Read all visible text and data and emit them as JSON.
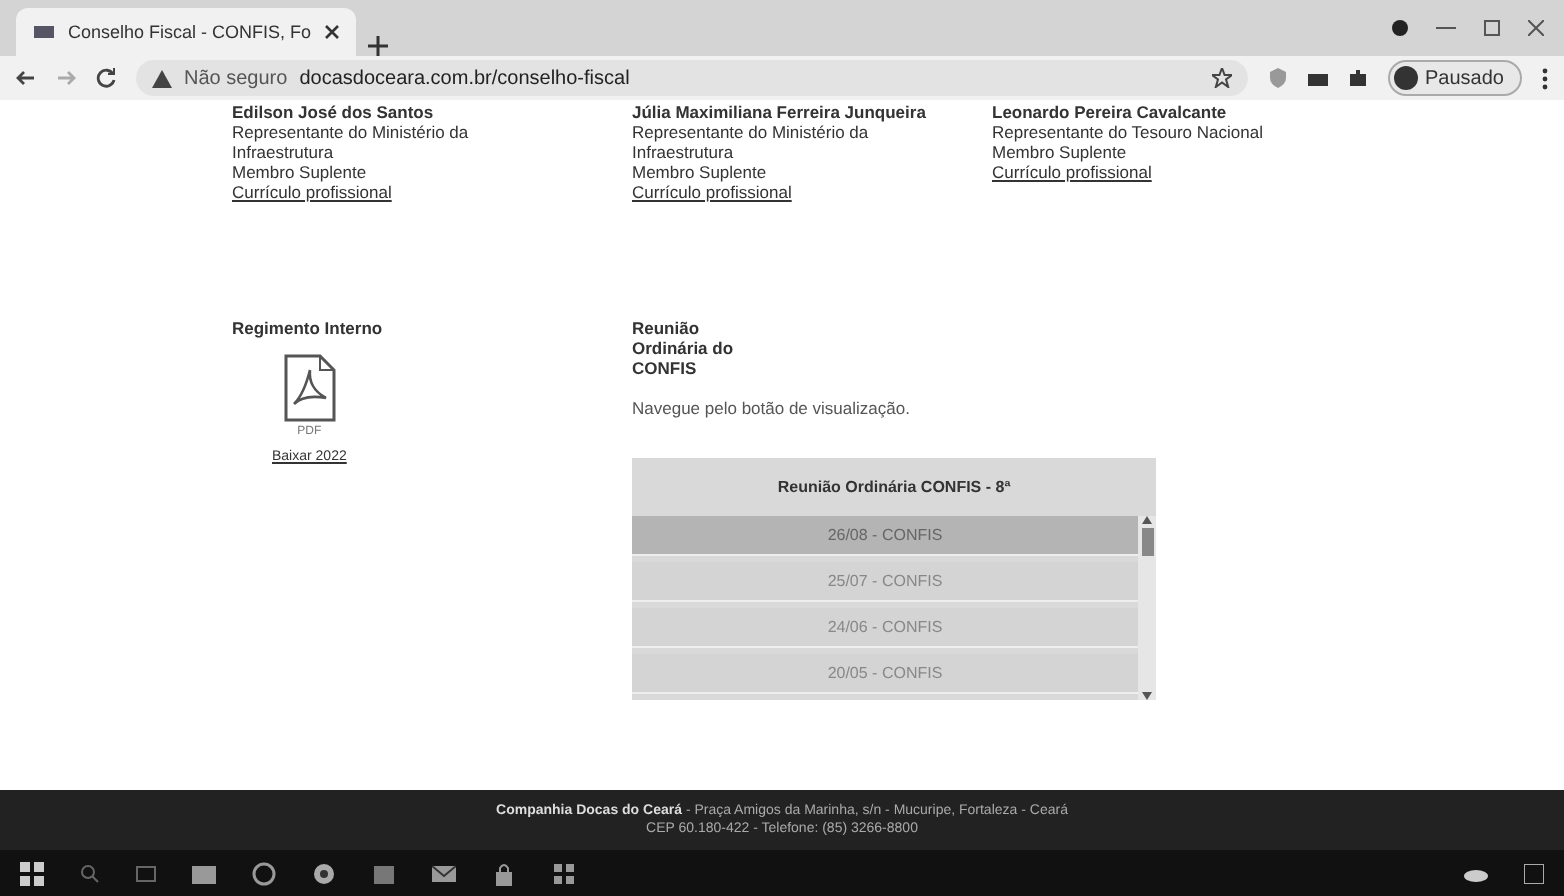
{
  "browser": {
    "tab": {
      "title": "Conselho Fiscal - CONFIS, Fo",
      "selected": true
    },
    "address": {
      "security": "Não seguro",
      "url": "docasdoceara.com.br/conselho-fiscal"
    },
    "profile": "Pausado"
  },
  "members": [
    {
      "name": "Edilson José dos Santos",
      "role": "Representante do Ministério da Infraestrutura",
      "status": "Membro Suplente",
      "link": "Currículo profissional"
    },
    {
      "name": "Júlia Maximiliana Ferreira Junqueira",
      "role": "Representante do Ministério da Infraestrutura",
      "status": "Membro Suplente",
      "link": "Currículo profissional"
    },
    {
      "name": "Leonardo Pereira Cavalcante",
      "role": "Representante do Tesouro Nacional",
      "status": "Membro Suplente",
      "link": "Currículo profissional"
    }
  ],
  "regimento": {
    "title": "Regimento Interno",
    "file_type": "PDF",
    "link": "Baixar 2022"
  },
  "reunioes": {
    "title": "Reunião Ordinária do CONFIS",
    "hint": "Navegue pelo botão de visualização.",
    "table_header": "Reunião Ordinária CONFIS - 8ª",
    "rows": [
      {
        "label": "26/08 - CONFIS",
        "selected": true
      },
      {
        "label": "25/07 - CONFIS",
        "selected": false
      },
      {
        "label": "24/06 - CONFIS",
        "selected": false
      },
      {
        "label": "20/05 - CONFIS",
        "selected": false
      }
    ]
  },
  "footer": {
    "company": "Companhia Docas do Ceará",
    "address": "- Praça Amigos da Marinha, s/n - Mucuripe, Fortaleza - Ceará",
    "contact": "CEP 60.180-422 - Telefone: (85) 3266-8800"
  }
}
